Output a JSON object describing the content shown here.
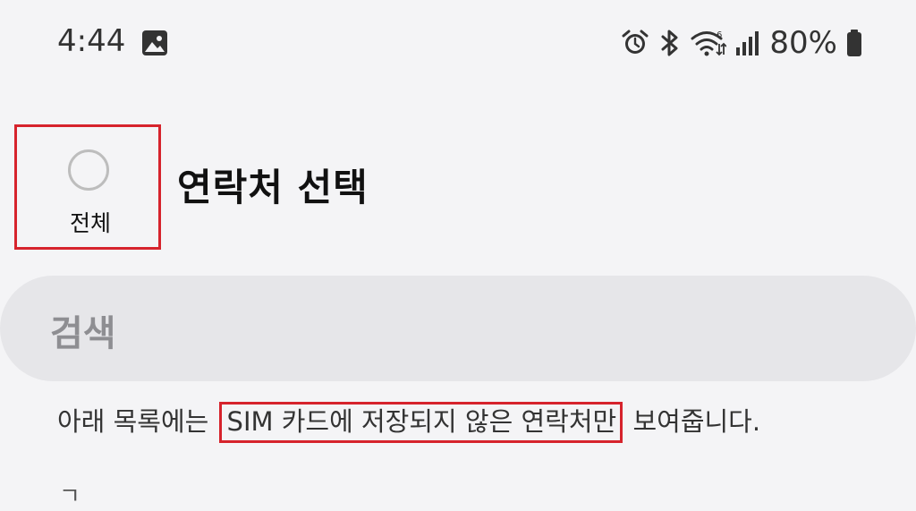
{
  "status_bar": {
    "time": "4:44",
    "battery": "80%",
    "icons": [
      "gallery-icon",
      "alarm-icon",
      "bluetooth-icon",
      "wifi-icon",
      "signal-icon",
      "battery-icon"
    ]
  },
  "header": {
    "select_all_label": "전체",
    "title": "연락처 선택"
  },
  "search": {
    "placeholder": "검색"
  },
  "notice": {
    "prefix": "아래 목록에는 ",
    "highlight": "SIM 카드에 저장되지 않은 연락처만",
    "suffix": " 보여줍니다."
  },
  "list": {
    "first_index": "ㄱ"
  },
  "colors": {
    "background": "#f4f4f6",
    "search_bg": "#e6e6e9",
    "highlight_box": "#d6232c"
  }
}
